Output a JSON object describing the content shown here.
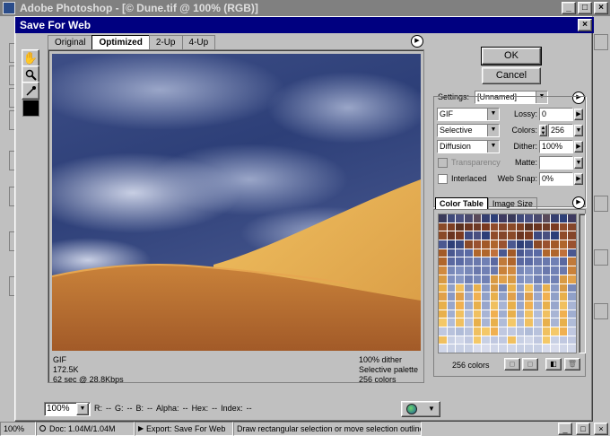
{
  "app": {
    "title": "Adobe Photoshop - [© Dune.tif @ 100% (RGB)]"
  },
  "dialog": {
    "title": "Save For Web"
  },
  "tabs": [
    {
      "label": "Original",
      "active": false
    },
    {
      "label": "Optimized",
      "active": true
    },
    {
      "label": "2-Up",
      "active": false
    },
    {
      "label": "4-Up",
      "active": false
    }
  ],
  "image_info": {
    "left": [
      "GIF",
      "172.5K",
      "62 sec @ 28.8Kbps"
    ],
    "right": [
      "100% dither",
      "Selective palette",
      "256 colors"
    ]
  },
  "buttons": {
    "ok": "OK",
    "cancel": "Cancel"
  },
  "settings": {
    "label": "Settings:",
    "preset": "[Unnamed]",
    "format": "GIF",
    "palette": "Selective",
    "dither_algorithm": "Diffusion",
    "lossy_label": "Lossy:",
    "lossy": "0",
    "colors_label": "Colors:",
    "colors": "256",
    "dither_label": "Dither:",
    "dither": "100%",
    "matte_label": "Matte:",
    "matte": "",
    "websnap_label": "Web Snap:",
    "websnap": "0%",
    "transparency_label": "Transparency",
    "interlaced_label": "Interlaced"
  },
  "color_table": {
    "tab_color_table": "Color Table",
    "tab_image_size": "Image Size",
    "count_label": "256 colors"
  },
  "bottom_bar": {
    "zoom": "100%",
    "readout": [
      "R:",
      "--",
      "G:",
      "--",
      "B:",
      "--",
      "Alpha:",
      "--",
      "Hex:",
      "--",
      "Index:",
      "--"
    ]
  },
  "status": {
    "zoom": "100%",
    "doc": "Doc: 1.04M/1.04M",
    "export": "Export: Save For Web",
    "hint": "Draw rectangular selection or move selection outline.  Use Shif"
  },
  "colors": {
    "sky_dark": "#2d3f78",
    "sky_light": "#9aa6c8",
    "dune_light": "#e8b04c",
    "dune_shadow": "#b0662c",
    "title_active": "#000080"
  },
  "icons": [
    "hand-icon",
    "zoom-icon",
    "eyedropper-icon",
    "globe-icon",
    "menu-arrow-icon"
  ]
}
